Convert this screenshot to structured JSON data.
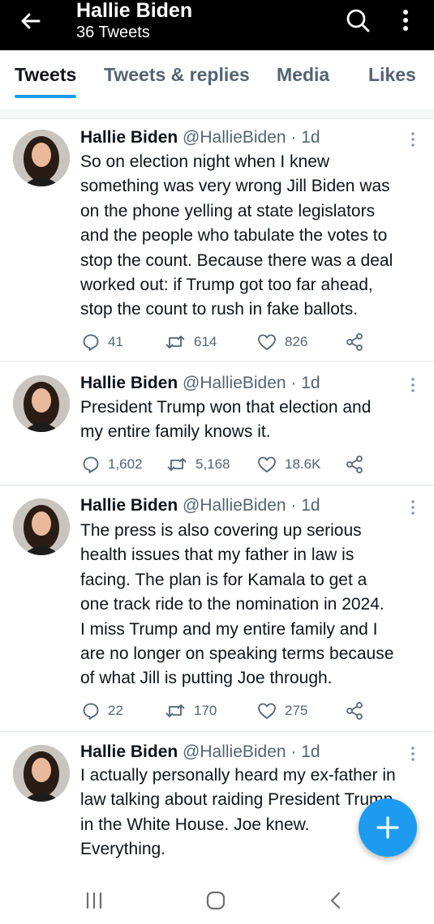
{
  "header": {
    "title": "Hallie Biden",
    "subtitle": "36 Tweets",
    "back_icon": "arrow-left-icon",
    "search_icon": "search-icon",
    "more_icon": "more-vertical-icon"
  },
  "tabs": [
    {
      "label": "Tweets",
      "active": true
    },
    {
      "label": "Tweets & replies",
      "active": false
    },
    {
      "label": "Media",
      "active": false
    },
    {
      "label": "Likes",
      "active": false
    }
  ],
  "tweets": [
    {
      "name": "Hallie Biden",
      "meta": "@HallieBiden · 1d",
      "lines": [
        "So on election night when I knew",
        "something was very wrong Jill Biden was",
        "on the phone yelling at state legislators",
        "and the people who tabulate the votes to",
        "stop the count. Because there was a deal",
        "worked out: if Trump got too far ahead,",
        "stop the count to rush in fake ballots."
      ],
      "replies": "41",
      "retweets": "614",
      "likes": "826"
    },
    {
      "name": "Hallie Biden",
      "meta": "@HallieBiden · 1d",
      "lines": [
        "President Trump won that election and",
        "my entire family knows it."
      ],
      "replies": "1,602",
      "retweets": "5,168",
      "likes": "18.6K"
    },
    {
      "name": "Hallie Biden",
      "meta": "@HallieBiden · 1d",
      "lines": [
        "The press is also covering up serious",
        "health issues that my father in law is",
        "facing. The plan is for Kamala to get a",
        "one track ride to the nomination in 2024.",
        "I miss Trump and my entire family and I",
        "are no longer on speaking terms because",
        "of what Jill is putting Joe through."
      ],
      "replies": "22",
      "retweets": "170",
      "likes": "275"
    },
    {
      "name": "Hallie Biden",
      "meta": "@HallieBiden · 1d",
      "lines": [
        "I actually personally heard my ex-father in",
        "law talking about raiding President Trump",
        "in the White House. Joe knew.",
        "Everything."
      ]
    }
  ],
  "fab": {
    "icon": "plus-icon"
  },
  "system_nav": {
    "recents_icon": "recents-icon",
    "home_icon": "home-icon",
    "back_icon": "back-chevron-icon"
  },
  "colors": {
    "accent": "#1d9bf0",
    "topbar": "#000000",
    "secondary_text": "#536471"
  }
}
